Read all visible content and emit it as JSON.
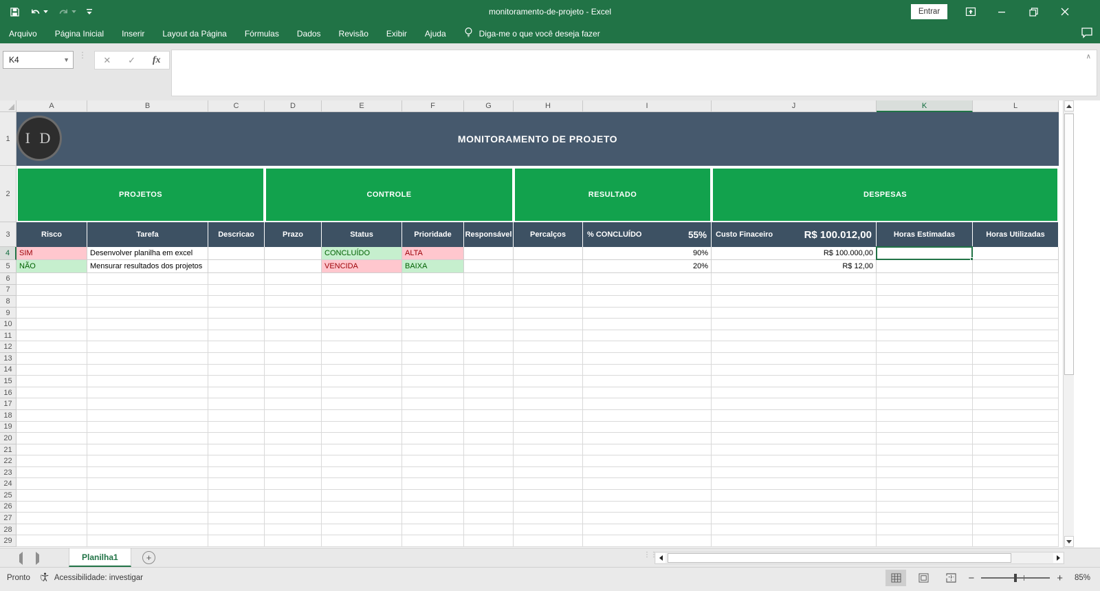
{
  "colors": {
    "excel_green": "#217346",
    "banner_slate": "#46596D",
    "header_slate": "#3D5163",
    "section_green": "#12A24D",
    "bad_bg": "#FFC7CE",
    "bad_text": "#9C0006",
    "good_bg": "#C6EFCE",
    "good_text": "#006100"
  },
  "titlebar": {
    "title": "monitoramento-de-projeto  -  Excel",
    "signin": "Entrar"
  },
  "menubar": {
    "items": [
      "Arquivo",
      "Página Inicial",
      "Inserir",
      "Layout da Página",
      "Fórmulas",
      "Dados",
      "Revisão",
      "Exibir",
      "Ajuda"
    ],
    "tell_me": "Diga-me o que você deseja fazer"
  },
  "formula_bar": {
    "name_box": "K4",
    "formula": ""
  },
  "grid": {
    "columns": [
      "A",
      "B",
      "C",
      "D",
      "E",
      "F",
      "G",
      "H",
      "I",
      "J",
      "K",
      "L"
    ],
    "selected_column": "K",
    "selected_row": "4",
    "selected_cell": "K4",
    "row_numbers": [
      "1",
      "2",
      "3",
      "4",
      "5",
      "6",
      "7",
      "8",
      "9",
      "10",
      "11",
      "12",
      "13",
      "14",
      "15",
      "16",
      "17",
      "18",
      "19",
      "20",
      "21",
      "22",
      "23",
      "24",
      "25",
      "26",
      "27",
      "28",
      "29"
    ],
    "banner": {
      "title": "MONITORAMENTO DE PROJETO",
      "logo": "I D"
    },
    "sections": [
      "PROJETOS",
      "CONTROLE",
      "RESULTADO",
      "DESPESAS"
    ],
    "header_cells": [
      {
        "text": "Risco"
      },
      {
        "text": "Tarefa"
      },
      {
        "text": "Descricao"
      },
      {
        "text": "Prazo"
      },
      {
        "text": "Status"
      },
      {
        "text": "Prioridade"
      },
      {
        "text": "Responsável"
      },
      {
        "text": "Percalços"
      },
      {
        "left": "% CONCLUÍDO",
        "right": "55%"
      },
      {
        "left": "Custo Finaceiro",
        "right": "R$ 100.012,00"
      },
      {
        "text": "Horas Estimadas"
      },
      {
        "text": "Horas Utilizadas"
      }
    ],
    "data_rows": [
      {
        "row": "4",
        "cells": [
          {
            "text": "SIM",
            "style": "bad"
          },
          {
            "text": "Desenvolver planilha em excel",
            "style": ""
          },
          {
            "text": "",
            "style": ""
          },
          {
            "text": "",
            "style": ""
          },
          {
            "text": "CONCLUÍDO",
            "style": "good"
          },
          {
            "text": "ALTA",
            "style": "bad"
          },
          {
            "text": "",
            "style": ""
          },
          {
            "text": "",
            "style": ""
          },
          {
            "text": "90%",
            "style": "num"
          },
          {
            "text": "R$ 100.000,00",
            "style": "num"
          },
          {
            "text": "",
            "style": "selected"
          },
          {
            "text": "",
            "style": ""
          }
        ]
      },
      {
        "row": "5",
        "cells": [
          {
            "text": "NÃO",
            "style": "good"
          },
          {
            "text": "Mensurar resultados dos projetos",
            "style": ""
          },
          {
            "text": "",
            "style": ""
          },
          {
            "text": "",
            "style": ""
          },
          {
            "text": "VENCIDA",
            "style": "bad"
          },
          {
            "text": "BAIXA",
            "style": "good"
          },
          {
            "text": "",
            "style": ""
          },
          {
            "text": "",
            "style": ""
          },
          {
            "text": "20%",
            "style": "num"
          },
          {
            "text": "R$ 12,00",
            "style": "num"
          },
          {
            "text": "",
            "style": ""
          },
          {
            "text": "",
            "style": ""
          }
        ]
      }
    ]
  },
  "sheet_tabs": {
    "active": "Planilha1"
  },
  "status_bar": {
    "mode": "Pronto",
    "accessibility": "Acessibilidade: investigar",
    "zoom_level": "85%"
  }
}
